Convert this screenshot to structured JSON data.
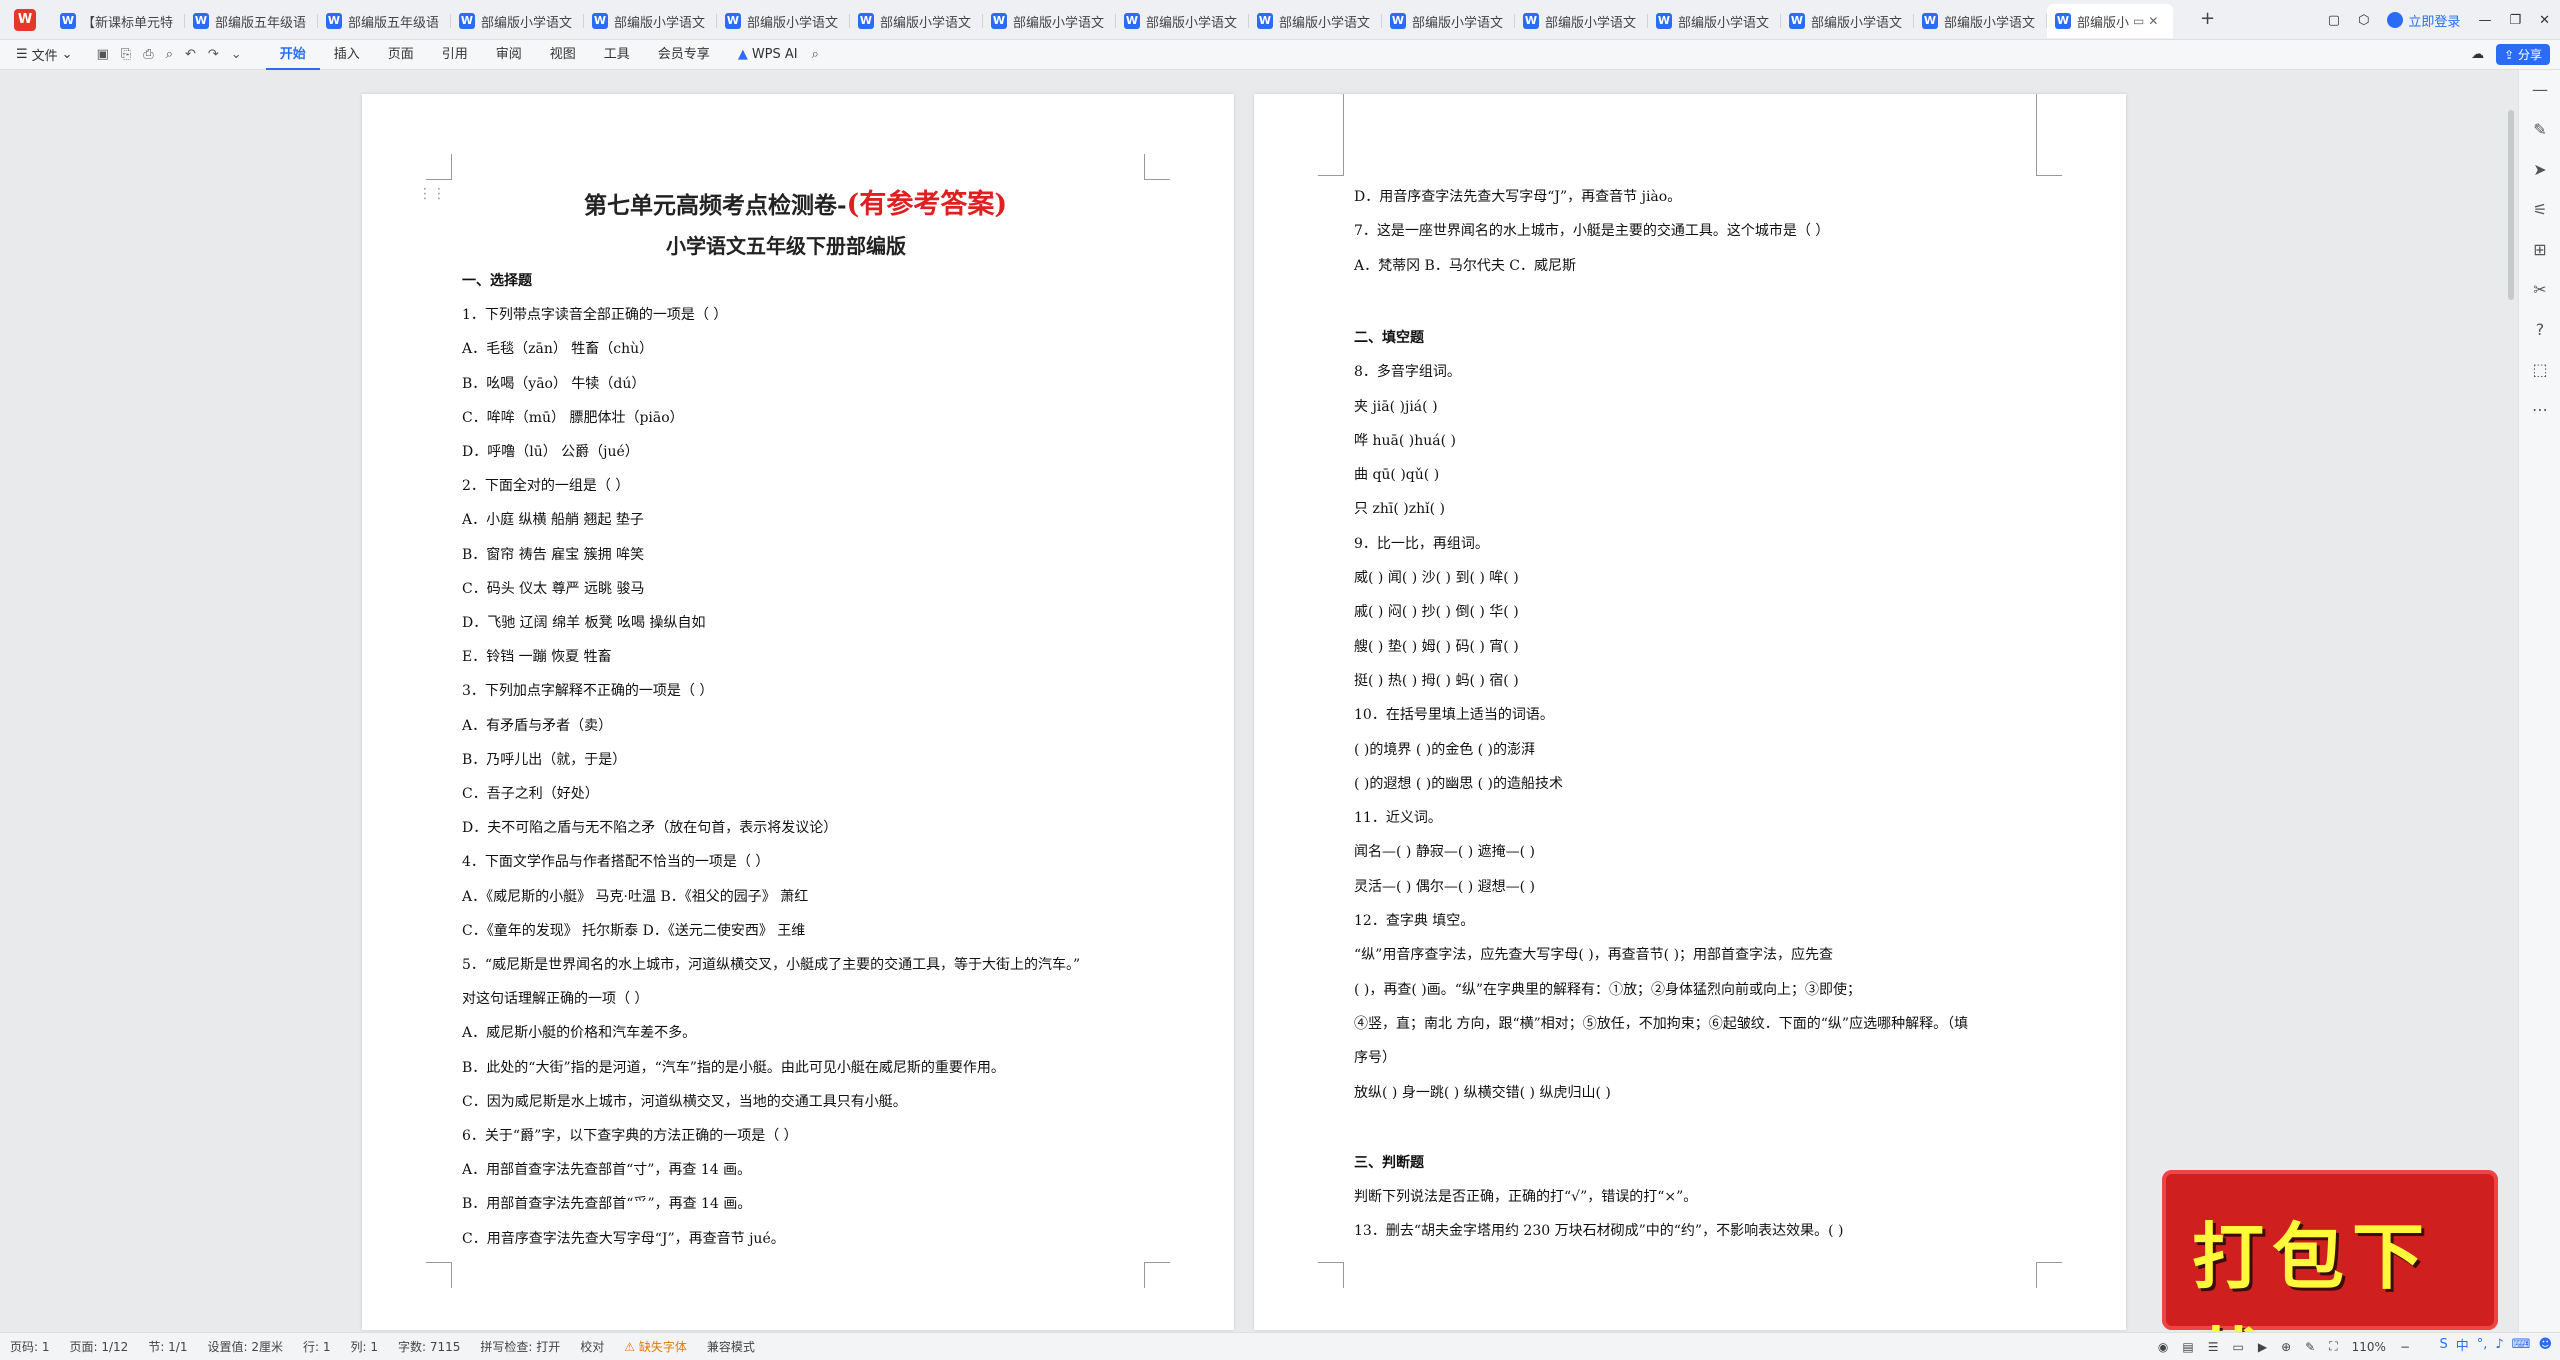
{
  "tabs": [
    {
      "label": "【新课标单元特"
    },
    {
      "label": "部编版五年级语"
    },
    {
      "label": "部编版五年级语"
    },
    {
      "label": "部编版小学语文"
    },
    {
      "label": "部编版小学语文"
    },
    {
      "label": "部编版小学语文"
    },
    {
      "label": "部编版小学语文"
    },
    {
      "label": "部编版小学语文"
    },
    {
      "label": "部编版小学语文"
    },
    {
      "label": "部编版小学语文"
    },
    {
      "label": "部编版小学语文"
    },
    {
      "label": "部编版小学语文"
    },
    {
      "label": "部编版小学语文"
    },
    {
      "label": "部编版小学语文"
    },
    {
      "label": "部编版小学语文"
    },
    {
      "label": "部编版小"
    }
  ],
  "topbar": {
    "login_label": "立即登录"
  },
  "ribbon": {
    "file_label": "文件",
    "menu": [
      "开始",
      "插入",
      "页面",
      "引用",
      "审阅",
      "视图",
      "工具",
      "会员专享"
    ],
    "ai_label": "WPS AI",
    "share_label": "分享"
  },
  "doc": {
    "title_main": "第七单元高频考点检测卷-",
    "title_red": "(有参考答案)",
    "subtitle": "小学语文五年级下册部编版",
    "page1_lines": [
      "一、选择题",
      "1．下列带点字读音全部正确的一项是（    ）",
      "A．毛毯（zān）             牲畜（chù）",
      "B．吆喝（yāo）   牛犊（dú）",
      "C．哞哞（mū）    膘肥体壮（piāo）",
      "D．呼噜（lū）    公爵（jué）",
      "2．下面全对的一组是（      ）",
      "A．小庭   纵横   船艄   翘起   垫子",
      "B．窗帘   祷告   雇宝   簇拥   哞笑",
      "C．码头   仪太   尊严   远眺   骏马",
      "D．飞驰   辽阔   绵羊   板凳   吆喝   操纵自如",
      "E．铃铛   一蹦   恢夏   牲畜",
      "3．下列加点字解释不正确的一项是（      ）",
      "A．有矛盾与矛者（卖）",
      "B．乃呼儿出（就，于是）",
      "C．吾子之利（好处）",
      "D．夫不可陷之盾与无不陷之矛（放在句首，表示将发议论）",
      "4．下面文学作品与作者搭配不恰当的一项是（    ）",
      "A．《威尼斯的小艇》 马克·吐温              B．《祖父的园子》 萧红",
      "C．《童年的发现》 托尔斯泰                  D．《送元二使安西》 王维",
      "5．“威尼斯是世界闻名的水上城市，河道纵横交叉，小艇成了主要的交通工具，等于大街上的汽车。”",
      "对这句话理解正确的一项（    ）",
      "A．威尼斯小艇的价格和汽车差不多。",
      "B．此处的“大街”指的是河道，“汽车”指的是小艇。由此可见小艇在威尼斯的重要作用。",
      "C．因为威尼斯是水上城市，河道纵横交叉，当地的交通工具只有小艇。",
      "6．关于“爵”字，以下查字典的方法正确的一项是（    ）",
      "A．用部首查字法先查部首“寸”，再查 14 画。",
      "B．用部首查字法先查部首“爫”，再查 14 画。",
      "C．用音序查字法先查大写字母“J”，再查音节 jué。"
    ],
    "page2_lines": [
      "D．用音序查字法先查大写字母“J”，再查音节 jiào。",
      "7．这是一座世界闻名的水上城市，小艇是主要的交通工具。这个城市是（      ）",
      "A．梵蒂冈                    B．马尔代夫                    C．威尼斯",
      "二、填空题",
      "8．多音字组词。",
      "夹 jiā(              )jiá(              )",
      "哗 huā(              )huá(              )",
      "曲 qū(               )qǔ(               )",
      "只 zhī(              )zhǐ(              )",
      "9．比一比，再组词。",
      "威(            )    闻(              )    沙(            )    到(              )    哞(              )",
      "戚(            )    闷(              )    抄(            )    倒(              )    华(              )",
      "艘(            )    垫(              )    姆(            )    码(              )    宵(              )",
      "挺(            )    热(              )    拇(            )    蚂(              )    宿(              )",
      "10．在括号里填上适当的词语。",
      "(              )的境界    (              )的金色    (              )的澎湃",
      "(              )的遐想    (              )的幽思    (              )的造船技术",
      "11．近义词。",
      "闻名—(          )        静寂—(          )    遮掩—(          )",
      "灵活—(          )        偶尔—(          )    遐想—(          )",
      "12．查字典 填空。",
      "“纵”用音序查字法，应先查大写字母(              )，再查音节(           )；用部首查字法，应先查",
      "(              )，再查(            )画。“纵”在字典里的解释有：①放；②身体猛烈向前或向上；③即使；",
      "④竖，直；南北 方向，跟“横”相对；⑤放任，不加拘束；⑥起皱纹．下面的“纵”应选哪种解释。（填",
      "序号）",
      "放纵(        )  身一跳(         )   纵横交错(          )   纵虎归山(          )",
      "三、判断题",
      "判断下列说法是否正确，正确的打“√”，错误的打“×”。",
      "13．删去“胡夫金字塔用约 230 万块石材砌成”中的“约”，不影响表达效果。(        )"
    ]
  },
  "download_badge": "打包下载",
  "statusbar": {
    "page": "页码: 1",
    "pages": "页面: 1/12",
    "section": "节: 1/1",
    "setting": "设置值: 2厘米",
    "row": "行: 1",
    "col": "列: 1",
    "words": "字数: 7115",
    "spell": "拼写检查: 打开",
    "proof": "校对",
    "missing_font": "缺失字体",
    "compat": "兼容模式",
    "zoom": "110%"
  },
  "ime": {
    "lang": "中"
  }
}
